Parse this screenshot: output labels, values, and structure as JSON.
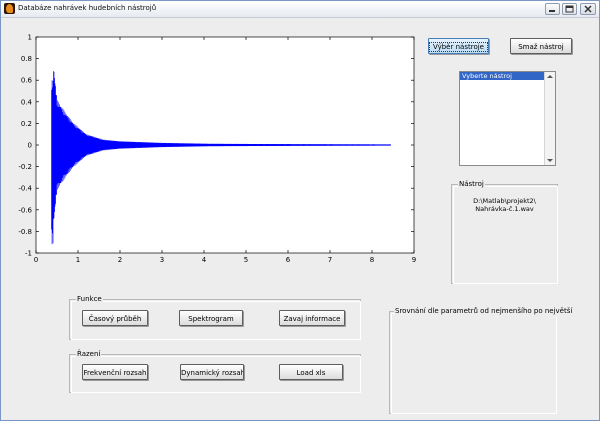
{
  "window": {
    "title": "Databáze nahrávek hudebních nástrojů",
    "controls": [
      "minimize-icon",
      "maximize-icon",
      "close-icon"
    ]
  },
  "chart_data": {
    "type": "line",
    "series": [
      {
        "color": "#0000ff"
      }
    ],
    "waveform": {
      "onset": 0.37,
      "peak_positive": 0.6,
      "peak_negative": -0.92,
      "envelope": [
        [
          0.37,
          0.93
        ],
        [
          0.5,
          0.42
        ],
        [
          0.7,
          0.3
        ],
        [
          0.9,
          0.2
        ],
        [
          1.2,
          0.1
        ],
        [
          1.6,
          0.05
        ],
        [
          2.0,
          0.035
        ],
        [
          3.0,
          0.02
        ],
        [
          4.1,
          0.012
        ],
        [
          5.0,
          0.01
        ],
        [
          8.4,
          0.006
        ]
      ],
      "end": 8.45
    },
    "xlim": [
      0,
      9
    ],
    "ylim": [
      -1,
      1
    ],
    "xticks": [
      "0",
      "1",
      "2",
      "3",
      "4",
      "5",
      "6",
      "7",
      "8",
      "9"
    ],
    "yticks": [
      "1",
      "0.8",
      "0.6",
      "0.4",
      "0.2",
      "0",
      "0.2",
      "0.4",
      "0.6",
      "0.8",
      "1"
    ],
    "grid": false
  },
  "buttons": {
    "select_instrument": "Výběr nástroje",
    "delete_instrument": "Smaž nástroj"
  },
  "instrument_list": {
    "selected_item": "Vyberte nástroj"
  },
  "instrument_panel": {
    "title": "Nástroj",
    "path_line1": "D:\\Matlab\\projekt2\\",
    "path_line2": "Nahrávka-č.1.wav"
  },
  "functions_panel": {
    "title": "Funkce",
    "time_course": "Časový průběh",
    "spectrogram": "Spektrogram",
    "envelope_info": "Zavaj informace"
  },
  "sort_panel": {
    "title": "Řazení",
    "frequency_range": "Frekvenční rozsah",
    "dynamic_range": "Dynamický rozsah",
    "load_xls": "Load xls"
  },
  "comparison_panel": {
    "title": "Srovnání dle parametrů od nejmenšího po největší"
  }
}
